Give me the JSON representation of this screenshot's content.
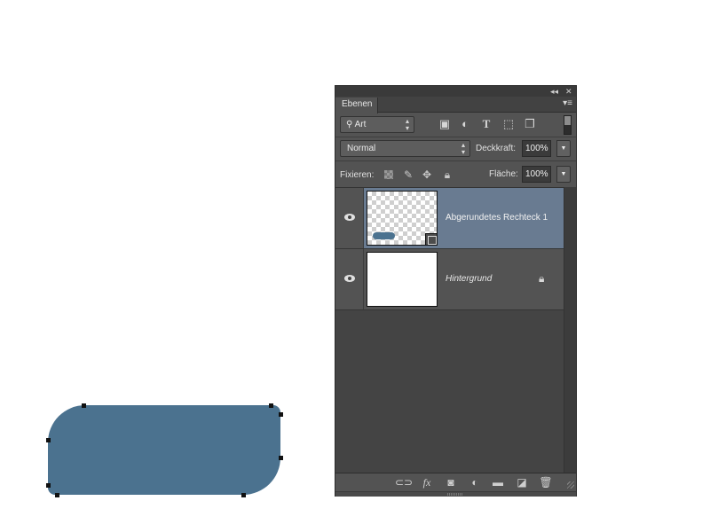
{
  "canvas": {
    "shape": {
      "name": "Abgerundetes Rechteck 1",
      "fill": "#4b728f"
    }
  },
  "panel": {
    "title_controls": {
      "collapse": "◂◂",
      "close": "✕"
    },
    "tab": "Ebenen",
    "menu_icon": "▾≡",
    "filter": {
      "kind_label": "Art",
      "icons": [
        "image-filter-icon",
        "adjustment-filter-icon",
        "type-filter-icon",
        "shape-filter-icon",
        "smart-object-filter-icon"
      ]
    },
    "blend_mode": "Normal",
    "opacity_label": "Deckkraft:",
    "opacity_value": "100%",
    "lock_label": "Fixieren:",
    "fill_label": "Fläche:",
    "fill_value": "100%",
    "layers": [
      {
        "name": "Abgerundetes Rechteck 1",
        "visible": true,
        "selected": true,
        "type": "shape",
        "locked": false
      },
      {
        "name": "Hintergrund",
        "visible": true,
        "selected": false,
        "type": "background",
        "locked": true
      }
    ],
    "footer_icons": [
      "link-layers-icon",
      "fx-icon",
      "mask-icon",
      "adjustment-layer-icon",
      "group-folder-icon",
      "new-layer-icon",
      "trash-icon"
    ],
    "colors": {
      "panel_bg": "#535353",
      "selected_row": "#697b91",
      "list_bg": "#444444"
    }
  }
}
